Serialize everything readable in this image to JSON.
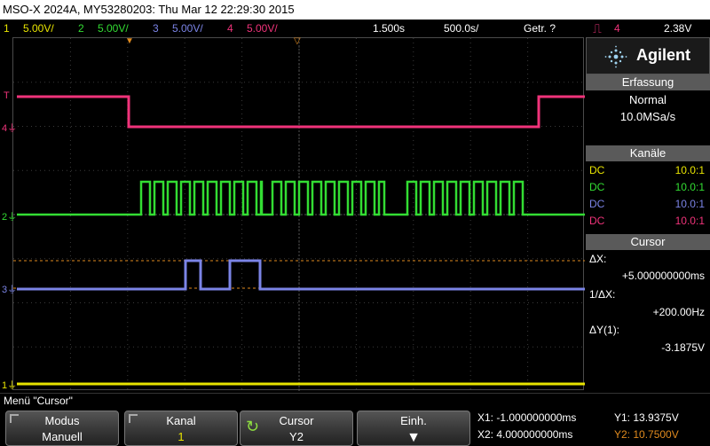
{
  "title": "MSO-X 2024A, MY53280203: Thu Mar 12 22:29:30 2015",
  "channels": [
    {
      "num": "1",
      "scale": "5.00V/",
      "color": "#e8e400"
    },
    {
      "num": "2",
      "scale": "5.00V/",
      "color": "#33dd33"
    },
    {
      "num": "3",
      "scale": "5.00V/",
      "color": "#7b84e6"
    },
    {
      "num": "4",
      "scale": "5.00V/",
      "color": "#f0337a"
    }
  ],
  "timebase": {
    "delay": "1.500s",
    "scale": "500.0s/"
  },
  "trigger": {
    "mode": "Getr.",
    "mode_suffix": "?",
    "source": "4",
    "level": "2.38V"
  },
  "brand": "Agilent",
  "acquisition": {
    "header": "Erfassung",
    "mode": "Normal",
    "rate": "10.0MSa/s"
  },
  "kanaele": {
    "header": "Kanäle",
    "rows": [
      {
        "coupling": "DC",
        "probe": "10.0:1",
        "color": "#e8e400"
      },
      {
        "coupling": "DC",
        "probe": "10.0:1",
        "color": "#33dd33"
      },
      {
        "coupling": "DC",
        "probe": "10.0:1",
        "color": "#7b84e6"
      },
      {
        "coupling": "DC",
        "probe": "10.0:1",
        "color": "#f0337a"
      }
    ]
  },
  "cursor": {
    "header": "Cursor",
    "dx_label": "ΔX:",
    "dx_value": "+5.000000000ms",
    "inv_label": "1/ΔX:",
    "inv_value": "+200.00Hz",
    "dy_label": "ΔY(1):",
    "dy_value": "-3.1875V"
  },
  "menu_title": "Menü \"Cursor\"",
  "softkeys": [
    {
      "label": "Modus",
      "value": "Manuell"
    },
    {
      "label": "Kanal",
      "value": "1"
    },
    {
      "label": "Cursor",
      "value": "Y2"
    },
    {
      "label": "Einh.",
      "value": ""
    }
  ],
  "readouts": {
    "x1": "X1: -1.000000000ms",
    "x2": "X2: 4.000000000ms",
    "y1": "Y1: 13.9375V",
    "y2": "Y2: 10.7500V"
  },
  "colors": {
    "ch1": "#e8e400",
    "ch2": "#33dd33",
    "ch3": "#7b84e6",
    "ch4": "#f0337a",
    "cursor": "#e08a1e"
  }
}
